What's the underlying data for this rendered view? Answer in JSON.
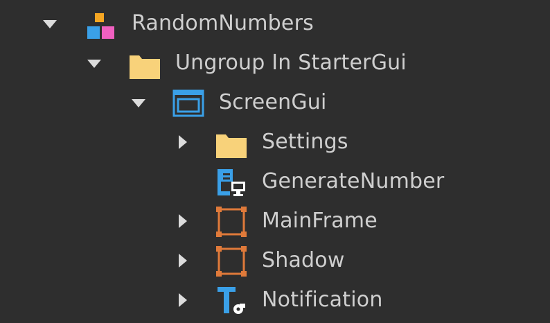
{
  "explorer": {
    "items": [
      {
        "label": "RandomNumbers",
        "icon": "model-icon",
        "expanded": true
      },
      {
        "label": "Ungroup In StarterGui",
        "icon": "folder-icon",
        "expanded": true
      },
      {
        "label": "ScreenGui",
        "icon": "screengui-icon",
        "expanded": true
      },
      {
        "label": "Settings",
        "icon": "folder-icon",
        "expanded": false
      },
      {
        "label": "GenerateNumber",
        "icon": "localscript-icon",
        "expanded": null
      },
      {
        "label": "MainFrame",
        "icon": "frame-icon",
        "expanded": false
      },
      {
        "label": "Shadow",
        "icon": "frame-icon",
        "expanded": false
      },
      {
        "label": "Notification",
        "icon": "textlabel-icon",
        "expanded": false
      }
    ]
  },
  "colors": {
    "background": "#2e2e2e",
    "text": "#cfcfcf",
    "arrow": "#dcdcdc",
    "folder": "#f8d27a",
    "screengui": "#3aa0e8",
    "frame": "#e07a3a",
    "script": "#3aa0e8",
    "model_orange": "#f5a623",
    "model_blue": "#3aa0e8",
    "model_pink": "#f060c0"
  }
}
